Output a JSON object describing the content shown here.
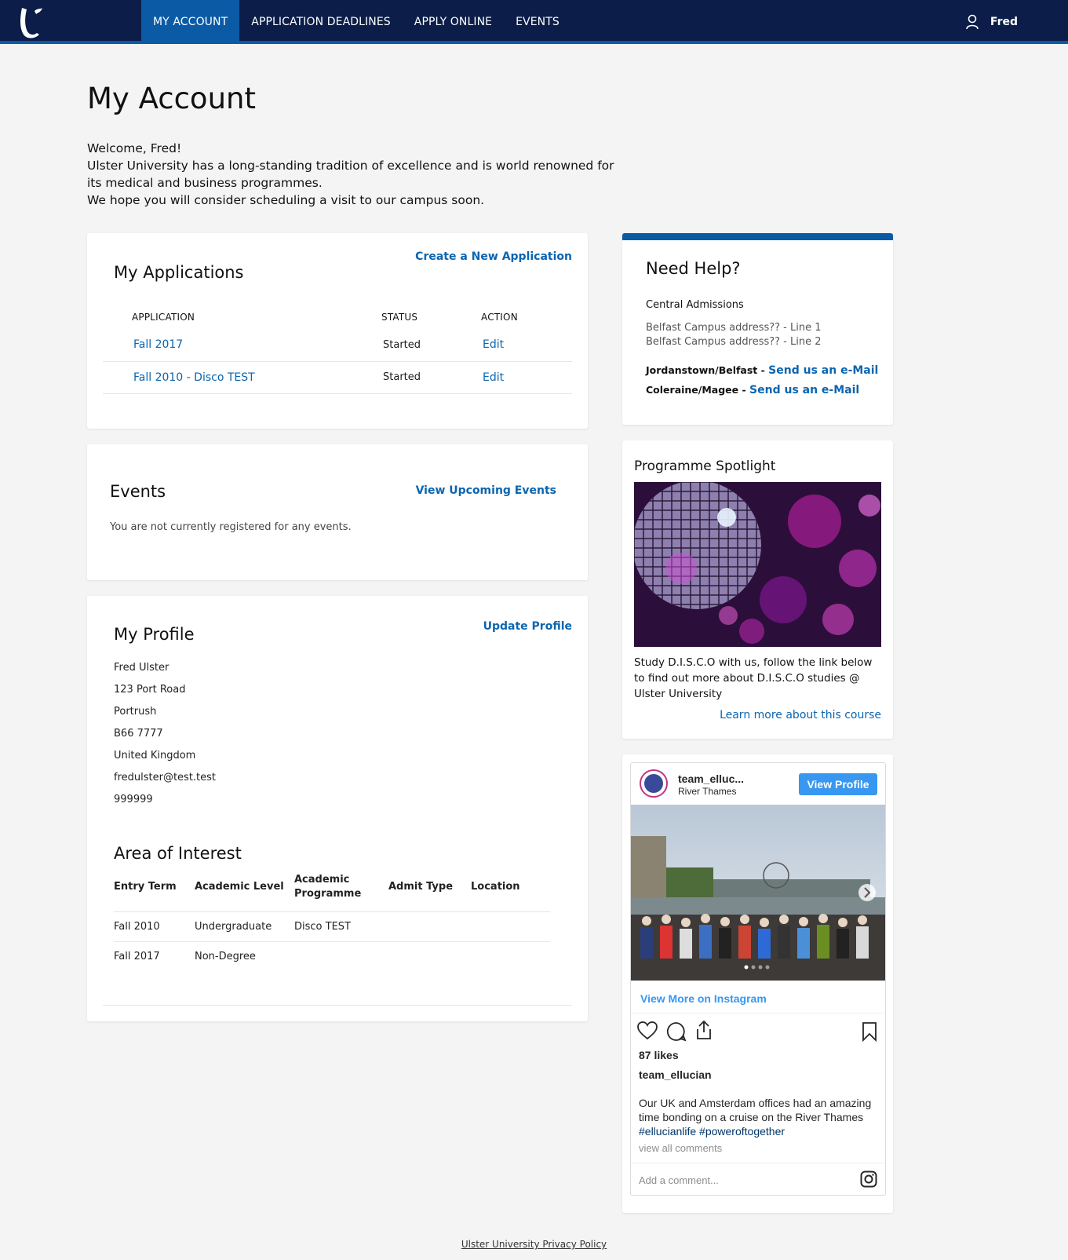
{
  "nav": {
    "items": [
      "MY ACCOUNT",
      "APPLICATION DEADLINES",
      "APPLY ONLINE",
      "EVENTS"
    ],
    "user": "Fred"
  },
  "page_title": "My Account",
  "welcome": {
    "line1": "Welcome, Fred!",
    "line2": "Ulster University has a long-standing tradition of excellence and is world renowned for its medical and business programmes.",
    "line3": "We hope you will consider scheduling a visit to our campus soon."
  },
  "applications": {
    "title": "My Applications",
    "create_link": "Create a New Application",
    "headers": [
      "APPLICATION",
      "STATUS",
      "ACTION"
    ],
    "rows": [
      {
        "name": "Fall 2017",
        "status": "Started",
        "action": "Edit"
      },
      {
        "name": "Fall 2010 - Disco TEST",
        "status": "Started",
        "action": "Edit"
      }
    ]
  },
  "events": {
    "title": "Events",
    "link": "View Upcoming Events",
    "message": "You are not currently registered for any events."
  },
  "profile": {
    "title": "My Profile",
    "update_link": "Update Profile",
    "lines": [
      "Fred Ulster",
      "123 Port Road",
      "Portrush",
      "B66 7777",
      "United Kingdom",
      "fredulster@test.test",
      "999999"
    ]
  },
  "interest": {
    "title": "Area of Interest",
    "headers": [
      "Entry Term",
      "Academic Level",
      "Academic Programme",
      "Admit Type",
      "Location"
    ],
    "rows": [
      [
        "Fall 2010",
        "Undergraduate",
        "Disco TEST",
        "",
        ""
      ],
      [
        "Fall 2017",
        "Non-Degree",
        "",
        "",
        ""
      ]
    ]
  },
  "help": {
    "title": "Need Help?",
    "subtitle": "Central Admissions",
    "addr1": "Belfast Campus address?? - Line 1",
    "addr2": "Belfast Campus address?? - Line 2",
    "c1_label": "Jordanstown/Belfast - ",
    "c1_link": "Send us an e-Mail",
    "c2_label": "Coleraine/Magee - ",
    "c2_link": "Send us an e-Mail"
  },
  "spotlight": {
    "title": "Programme Spotlight",
    "text": "Study D.I.S.C.O with us, follow the link below to find out more about D.I.S.C.O studies @ Ulster University",
    "link": "Learn more about this course"
  },
  "instagram": {
    "username": "team_elluc...",
    "location": "River Thames",
    "view_profile": "View Profile",
    "view_more": "View More on Instagram",
    "likes": "87 likes",
    "author": "team_ellucian",
    "caption": "Our UK and Amsterdam offices had an amazing time bonding on a cruise on the River Thames",
    "hashtags": "#ellucianlife #poweroftogether",
    "comments": "view all comments",
    "comment_placeholder": "Add a comment..."
  },
  "footer": {
    "link": "Ulster University Privacy Policy"
  },
  "colors": {
    "navy": "#0b1d48",
    "accent": "#0a5aa6",
    "link": "#0b65b0"
  }
}
